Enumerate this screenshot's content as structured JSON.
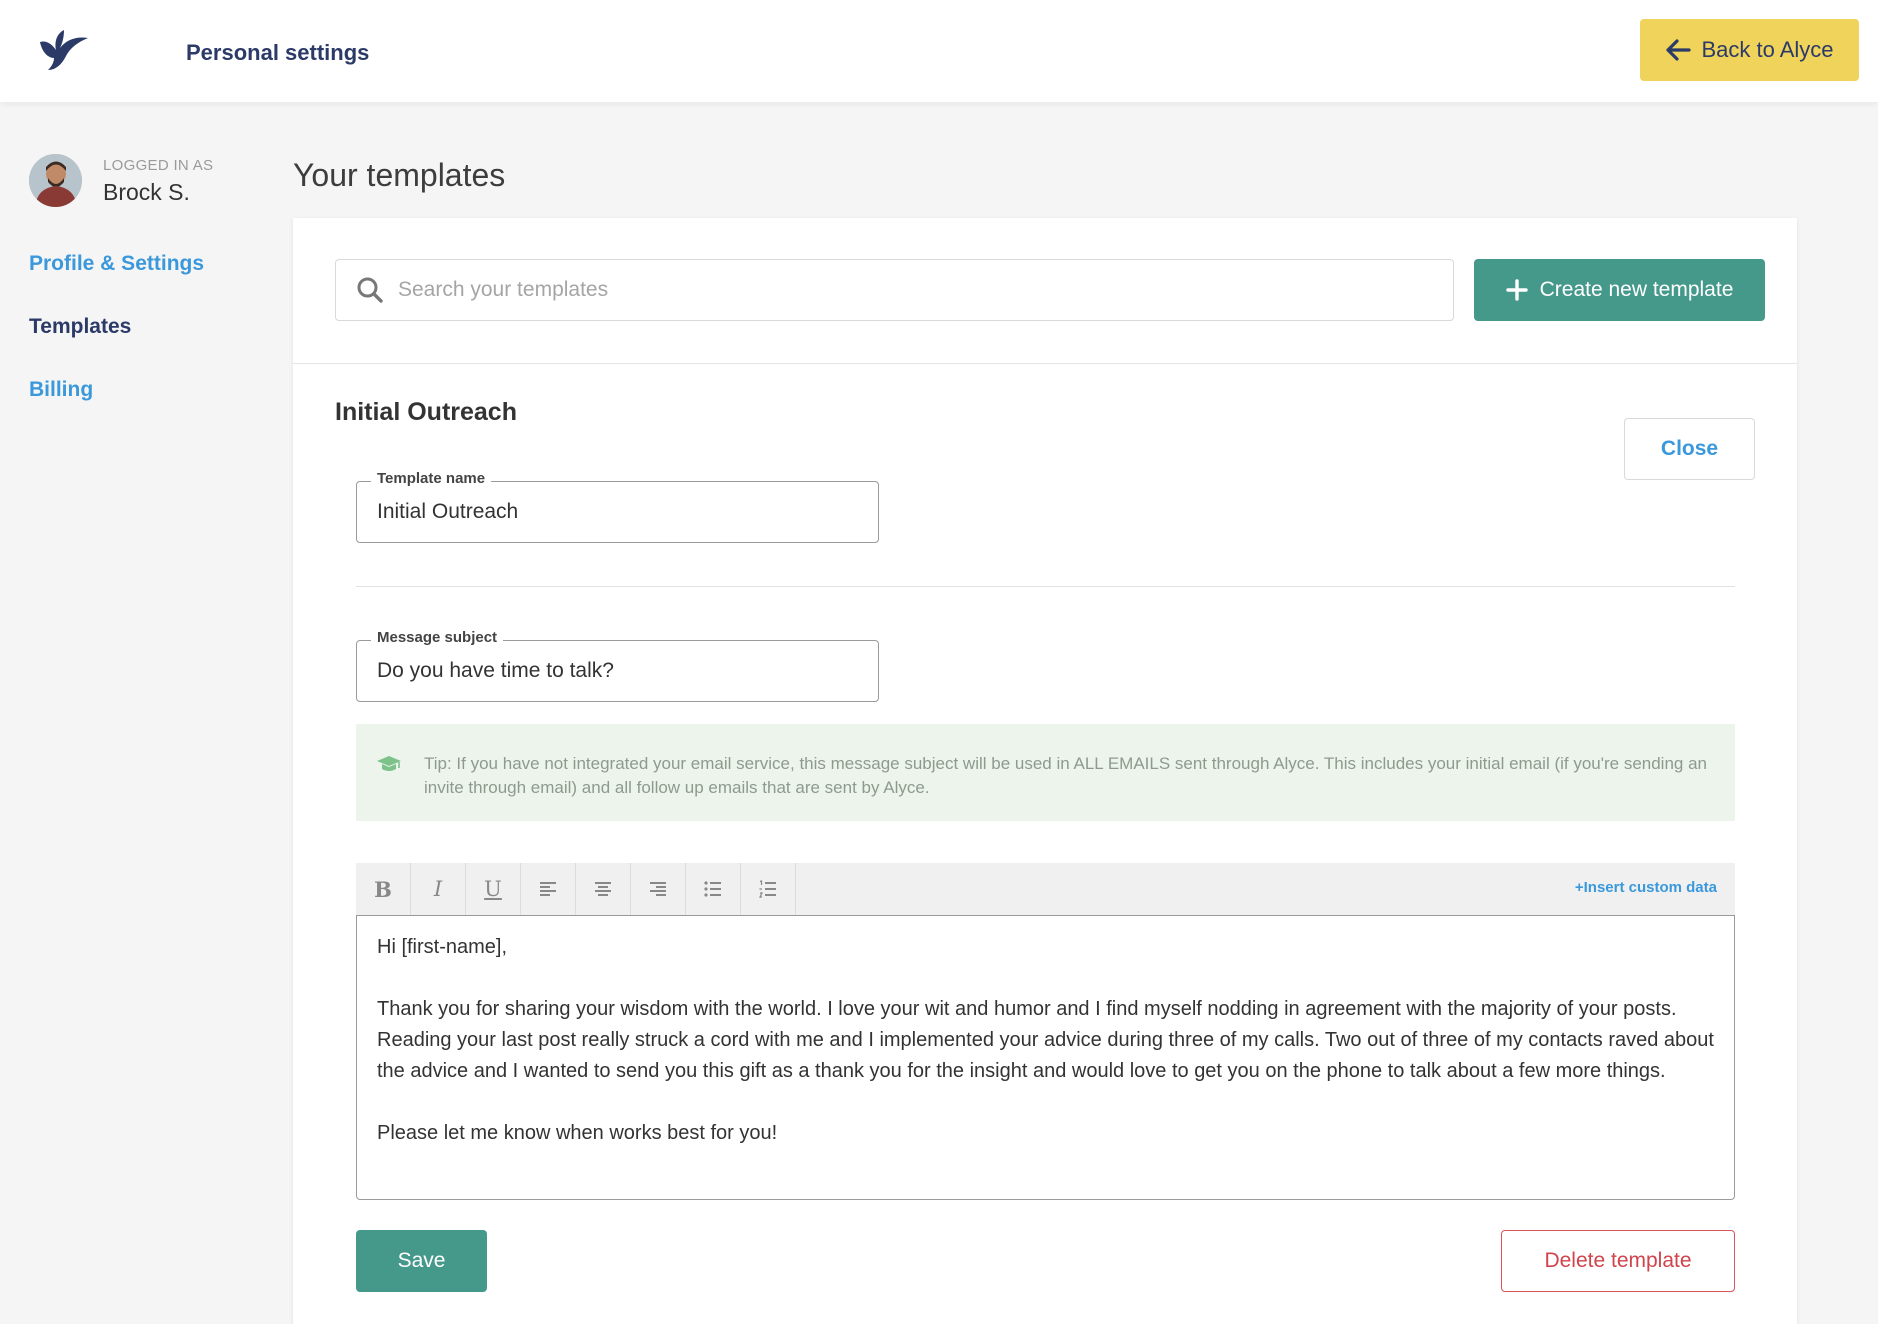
{
  "header": {
    "title": "Personal settings",
    "back_label": "Back to Alyce",
    "logo_icon": "bird-logo-icon",
    "accent_color": "#f0d35a"
  },
  "sidebar": {
    "logged_in_label": "LOGGED IN AS",
    "user_name": "Brock S.",
    "items": [
      {
        "label": "Profile & Settings",
        "active": false
      },
      {
        "label": "Templates",
        "active": true
      },
      {
        "label": "Billing",
        "active": false
      }
    ]
  },
  "main": {
    "title": "Your templates",
    "search": {
      "placeholder": "Search your templates",
      "value": ""
    },
    "create_label": "Create new template",
    "template": {
      "title": "Initial Outreach",
      "close_label": "Close",
      "name_field": {
        "label": "Template name",
        "value": "Initial Outreach"
      },
      "subject_field": {
        "label": "Message subject",
        "value": "Do you have time to talk?"
      },
      "tip": "Tip: If you have not integrated your email service, this message subject will be used in ALL EMAILS sent through Alyce. This includes your initial email (if you're sending an invite through email) and all follow up emails that are sent by Alyce.",
      "toolbar": {
        "bold": "B",
        "italic": "I",
        "underline": "U",
        "insert_label": "+Insert custom data"
      },
      "message": {
        "greeting": "Hi [first-name],",
        "body": "Thank you for sharing your wisdom with the world. I love your wit and humor and I find myself nodding in agreement with the majority of your posts. Reading your last post really struck a cord with me and I implemented your advice during three of my calls. Two out of three of my contacts raved about the advice and I wanted to send you this gift as a thank you for the insight and would love to get you on the phone to talk about a few more things.",
        "closing": "Please let me know when works best for you!"
      },
      "save_label": "Save",
      "delete_label": "Delete template"
    }
  },
  "colors": {
    "primary_green": "#45998b",
    "link_blue": "#3a98db",
    "navy": "#2b3a67",
    "danger": "#d0444c"
  }
}
